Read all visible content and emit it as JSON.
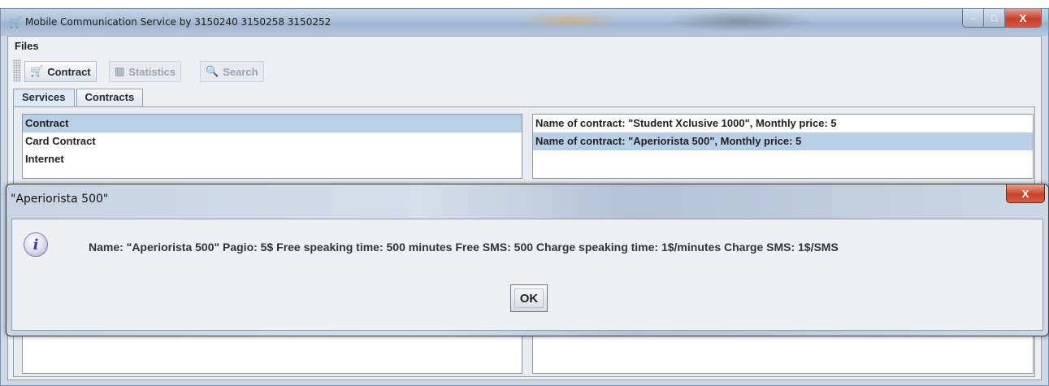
{
  "window": {
    "title": "Mobile Communication Service by 3150240 3150258 3150252",
    "icon": "cart-icon",
    "controls": {
      "minimize": "–",
      "maximize": "□",
      "close": "X"
    }
  },
  "menu": {
    "files": "Files"
  },
  "toolbar": {
    "contract": "Contract",
    "statistics": "Statistics",
    "search": "Search"
  },
  "tabs": {
    "services": "Services",
    "contracts": "Contracts"
  },
  "services_list": {
    "items": [
      "Contract",
      "Card Contract",
      "Internet"
    ],
    "selected": 0
  },
  "contracts_list": {
    "items": [
      "Name of contract: \"Student Xclusive 1000\", Monthly price: 5",
      "Name of contract: \"Aperiorista 500\", Monthly price: 5"
    ],
    "selected": 1
  },
  "dialog": {
    "title": "\"Aperiorista 500\"",
    "close": "X",
    "icon": "info-icon",
    "icon_glyph": "i",
    "message": "Name: \"Aperiorista 500\" Pagio: 5$ Free speaking time: 500 minutes Free SMS: 500 Charge speaking time: 1$/minutes Charge SMS: 1$/SMS",
    "ok": "OK"
  }
}
